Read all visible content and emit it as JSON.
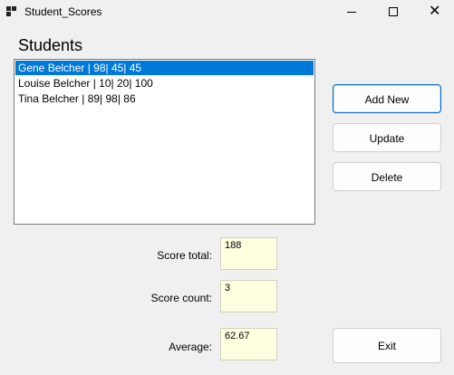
{
  "window": {
    "title": "Student_Scores",
    "minimize_glyph": "—",
    "maximize_glyph": "☐",
    "close_glyph": "✕"
  },
  "students_heading": "Students",
  "students": [
    "Gene Belcher | 98| 45| 45",
    "Louise Belcher | 10| 20| 100",
    "Tina Belcher | 89| 98| 86"
  ],
  "selected_index": 0,
  "buttons": {
    "add_new": "Add New",
    "update": "Update",
    "delete": "Delete",
    "exit": "Exit"
  },
  "stats": {
    "score_total_label": "Score total:",
    "score_total": "188",
    "score_count_label": "Score count:",
    "score_count": "3",
    "average_label": "Average:",
    "average": "62.67"
  },
  "colors": {
    "selection": "#0078d7",
    "readonly_field": "#ffffe0"
  }
}
